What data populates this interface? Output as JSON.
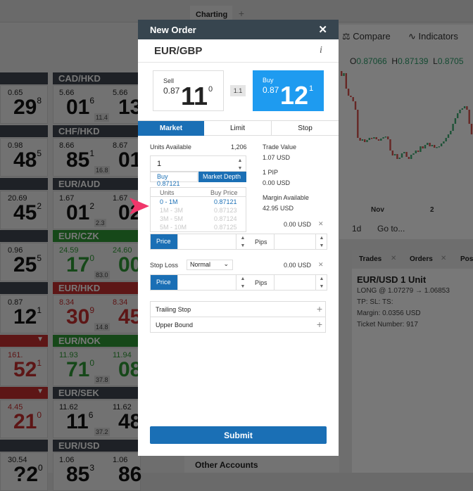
{
  "top_tabs": {
    "charting": "Charting",
    "add": "+"
  },
  "chart": {
    "compare": "Compare",
    "indicators": "Indicators",
    "ohlc": {
      "o_label": "O",
      "o": "0.87066",
      "h_label": "H",
      "h": "0.87139",
      "l_label": "L",
      "l": "0.8705"
    },
    "x_ticks": [
      "Nov",
      "2"
    ],
    "interval": "1d",
    "goto": "Go to..."
  },
  "trades_panel": {
    "tabs": [
      "Trades",
      "Orders",
      "Pos"
    ],
    "pair": "EUR/USD  1 Unit",
    "line1": "LONG @ 1.07279 → 1.06853",
    "line2": "TP:   SL:   TS:",
    "line3": "Margin: 0.0356 USD",
    "line4": "Ticket Number: 917"
  },
  "other_accounts": "Other Accounts",
  "tiles_left": [
    {
      "sell_top": "0.65",
      "sell_big": "29",
      "sell_sup": "8",
      "color": "default"
    },
    {
      "sell_top": "0.98",
      "sell_big": "48",
      "sell_sup": "5",
      "color": "default"
    },
    {
      "sell_top": "20.69",
      "sell_big": "45",
      "sell_sup": "2",
      "color": "default"
    },
    {
      "sell_top": "0.96",
      "sell_big": "25",
      "sell_sup": "5",
      "color": "default"
    },
    {
      "sell_top": "0.87",
      "sell_big": "12",
      "sell_sup": "1",
      "color": "default"
    },
    {
      "sell_top": "161.",
      "sell_big": "52",
      "sell_sup": "1",
      "color": "red"
    },
    {
      "sell_top": "4.45",
      "sell_big": "21",
      "sell_sup": "0",
      "color": "red"
    },
    {
      "sell_top": "30.54",
      "sell_big": "?2",
      "sell_sup": "0",
      "color": "default"
    }
  ],
  "tiles": [
    {
      "pair": "CAD/HKD",
      "sell_top": "5.66",
      "sell_big": "01",
      "sell_sup": "6",
      "spread": "11.4",
      "buy_top": "5.66",
      "buy_big": "13",
      "color": "default"
    },
    {
      "pair": "CHF/HKD",
      "sell_top": "8.66",
      "sell_big": "85",
      "sell_sup": "1",
      "spread": "16.8",
      "buy_top": "8.67",
      "buy_big": "01",
      "color": "default"
    },
    {
      "pair": "EUR/AUD",
      "sell_top": "1.67",
      "sell_big": "01",
      "sell_sup": "2",
      "spread": "2.3",
      "buy_top": "1.67",
      "buy_big": "02",
      "color": "default"
    },
    {
      "pair": "EUR/CZK",
      "sell_top": "24.59",
      "sell_big": "17",
      "sell_sup": "0",
      "spread": "83.0",
      "buy_top": "24.60",
      "buy_big": "00",
      "color": "green"
    },
    {
      "pair": "EUR/HKD",
      "sell_top": "8.34",
      "sell_big": "30",
      "sell_sup": "9",
      "spread": "14.8",
      "buy_top": "8.34",
      "buy_big": "45",
      "color": "red"
    },
    {
      "pair": "EUR/NOK",
      "sell_top": "11.93",
      "sell_big": "71",
      "sell_sup": "0",
      "spread": "37.8",
      "buy_top": "11.94",
      "buy_big": "08",
      "color": "green"
    },
    {
      "pair": "EUR/SEK",
      "sell_top": "11.62",
      "sell_big": "11",
      "sell_sup": "6",
      "spread": "37.2",
      "buy_top": "11.62",
      "buy_big": "48",
      "color": "default"
    },
    {
      "pair": "EUR/USD",
      "sell_top": "1.06",
      "sell_big": "85",
      "sell_sup": "3",
      "spread": "",
      "buy_top": "1.06",
      "buy_big": "86",
      "color": "default"
    }
  ],
  "dialog": {
    "title": "New Order",
    "close": "✕",
    "pair": "EUR/GBP",
    "info": "i",
    "sell": {
      "label": "Sell",
      "prefix": "0.87",
      "big": "11",
      "sup": "0"
    },
    "spread": "1.1",
    "buy": {
      "label": "Buy",
      "prefix": "0.87",
      "big": "12",
      "sup": "1"
    },
    "tabs": [
      "Market",
      "Limit",
      "Stop"
    ],
    "active_tab": "Market",
    "units_label": "Units Available",
    "units_available": "1,206",
    "units_value": "1",
    "buy_price_link": "Buy 0.87121",
    "market_depth": "Market Depth",
    "depth": {
      "headers": [
        "Units",
        "Buy Price"
      ],
      "rows": [
        [
          "0 - 1M",
          "0.87121"
        ],
        [
          "1M - 3M",
          "0.87123"
        ],
        [
          "3M - 5M",
          "0.87124"
        ],
        [
          "5M - 10M",
          "0.87125"
        ]
      ]
    },
    "trade_value_label": "Trade Value",
    "trade_value": "1.07 USD",
    "pip_label": "1 PIP",
    "pip_value": "0.00 USD",
    "margin_label": "Margin Available",
    "margin_value": "42.95 USD",
    "take_profit_amount": "0.00 USD",
    "price_label": "Price",
    "pips_label": "Pips",
    "stop_loss_label": "Stop Loss",
    "stop_loss_type": "Normal",
    "stop_loss_amount": "0.00 USD",
    "trailing_stop": "Trailing Stop",
    "upper_bound": "Upper Bound",
    "submit": "Submit"
  },
  "colors": {
    "accent": "#1a6fb5",
    "buy": "#1e9bf0",
    "header": "#37454f",
    "pointer": "#f0366a"
  }
}
